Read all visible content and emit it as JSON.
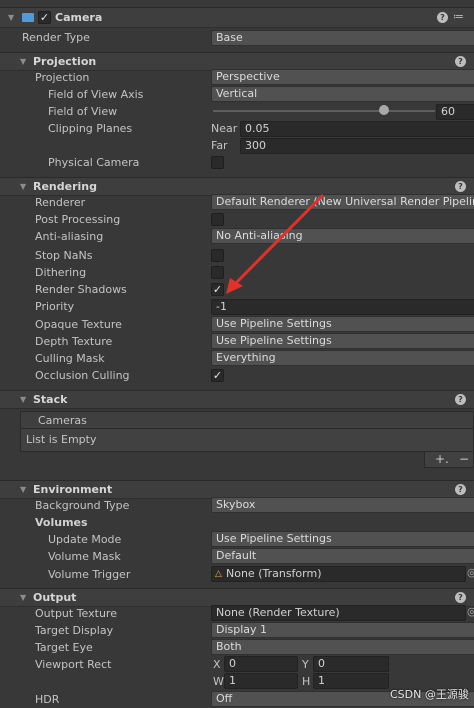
{
  "camera": {
    "title": "Camera",
    "render_type_label": "Render Type",
    "render_type_value": "Base"
  },
  "projection": {
    "title": "Projection",
    "projection_label": "Projection",
    "projection_value": "Perspective",
    "fov_axis_label": "Field of View Axis",
    "fov_axis_value": "Vertical",
    "fov_label": "Field of View",
    "fov_value": "60",
    "fov_fraction": 0.77,
    "clipping_label": "Clipping Planes",
    "near_label": "Near",
    "near_value": "0.05",
    "far_label": "Far",
    "far_value": "300",
    "physical_label": "Physical Camera"
  },
  "rendering": {
    "title": "Rendering",
    "renderer_label": "Renderer",
    "renderer_value": "Default Renderer (New Universal Render Pipeline As",
    "post_label": "Post Processing",
    "aa_label": "Anti-aliasing",
    "aa_value": "No Anti-aliasing",
    "stopnans_label": "Stop NaNs",
    "dither_label": "Dithering",
    "shadows_label": "Render Shadows",
    "priority_label": "Priority",
    "priority_value": "-1",
    "opaque_label": "Opaque Texture",
    "opaque_value": "Use Pipeline Settings",
    "depth_label": "Depth Texture",
    "depth_value": "Use Pipeline Settings",
    "culling_label": "Culling Mask",
    "culling_value": "Everything",
    "occlusion_label": "Occlusion Culling"
  },
  "stack": {
    "title": "Stack",
    "cameras_label": "Cameras",
    "empty_label": "List is Empty",
    "add_label": "+.",
    "remove_label": "−"
  },
  "environment": {
    "title": "Environment",
    "bg_label": "Background Type",
    "bg_value": "Skybox",
    "volumes_label": "Volumes",
    "update_label": "Update Mode",
    "update_value": "Use Pipeline Settings",
    "mask_label": "Volume Mask",
    "mask_value": "Default",
    "trigger_label": "Volume Trigger",
    "trigger_value": "None (Transform)"
  },
  "output": {
    "title": "Output",
    "texture_label": "Output Texture",
    "texture_value": "None (Render Texture)",
    "display_label": "Target Display",
    "display_value": "Display 1",
    "eye_label": "Target Eye",
    "eye_value": "Both",
    "viewport_label": "Viewport Rect",
    "x_label": "X",
    "x_value": "0",
    "y_label": "Y",
    "y_value": "0",
    "w_label": "W",
    "w_value": "1",
    "h_label": "H",
    "h_value": "1",
    "hdr_label": "HDR",
    "hdr_value": "Off"
  },
  "watermark": "CSDN @王源骏",
  "colors": {
    "annotation_arrow": "#e0312b",
    "panel": "#383838",
    "field": "#2a2a2a",
    "dropdown": "#515151"
  }
}
